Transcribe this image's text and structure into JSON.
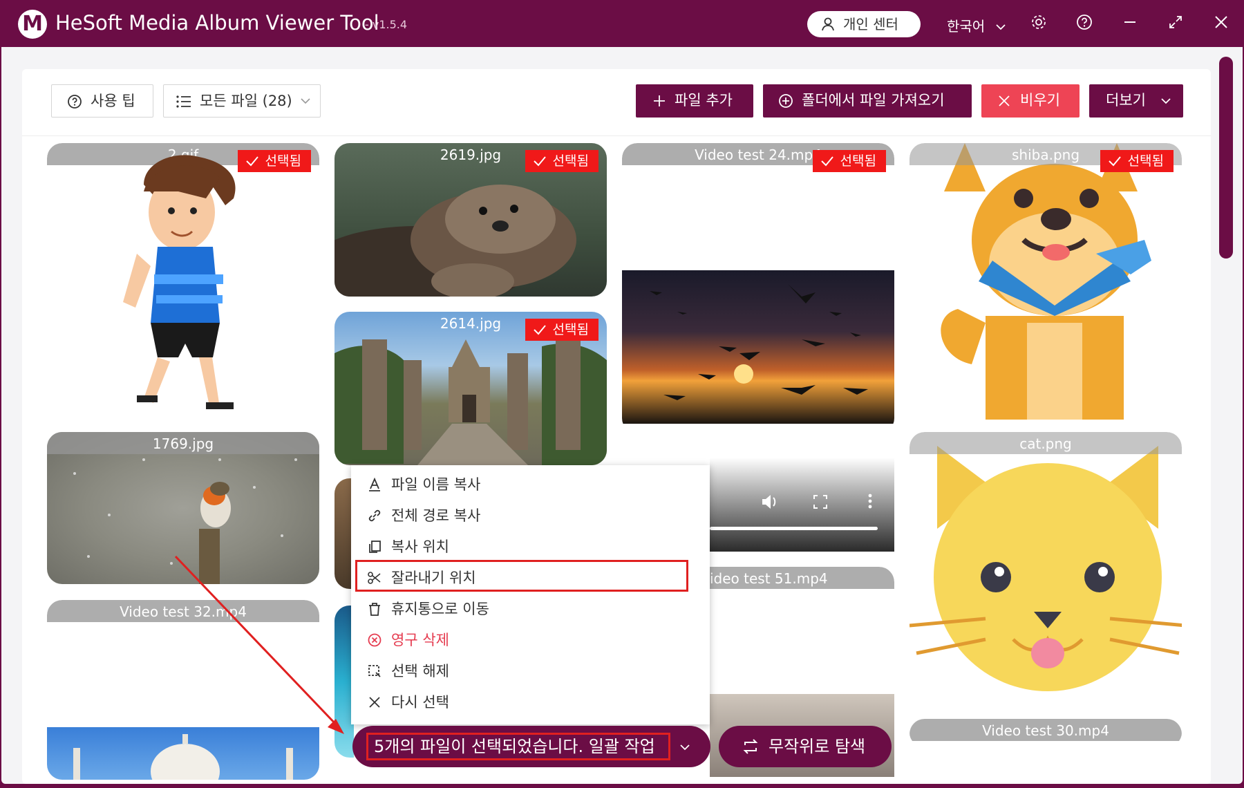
{
  "app": {
    "logo_letter": "M",
    "title": "HeSoft Media Album Viewer Tool",
    "version": "- v1.5.4",
    "user_center": "개인 센터",
    "language": "한국어"
  },
  "toolbar": {
    "tips_label": "사용 팁",
    "filter_label": "모든 파일 (28)",
    "add_file_label": "파일 추가",
    "import_folder_label": "폴더에서 파일 가져오기",
    "clear_label": "비우기",
    "more_label": "더보기"
  },
  "selected_badge": "선택됨",
  "cards": [
    {
      "name": "2.gif",
      "selected": true
    },
    {
      "name": "2619.jpg",
      "selected": true
    },
    {
      "name": "Video test 24.mp4",
      "selected": true
    },
    {
      "name": "shiba.png",
      "selected": true
    },
    {
      "name": "2614.jpg",
      "selected": true
    },
    {
      "name": "1769.jpg",
      "selected": false
    },
    {
      "name": "cat.png",
      "selected": false
    },
    {
      "name": "Video test 32.mp4",
      "selected": false
    },
    {
      "name": "ideo test 51.mp4",
      "selected": false
    },
    {
      "name": "Video test 30.mp4",
      "selected": false
    }
  ],
  "context_menu": {
    "items": [
      {
        "label": "파일 이름 복사",
        "icon": "text-a-icon"
      },
      {
        "label": "전체 경로 복사",
        "icon": "link-icon"
      },
      {
        "label": "복사 위치",
        "icon": "copy-icon"
      },
      {
        "label": "잘라내기 위치",
        "icon": "scissors-icon"
      },
      {
        "label": "휴지통으로 이동",
        "icon": "trash-icon"
      },
      {
        "label": "영구 삭제",
        "icon": "circle-x-icon"
      },
      {
        "label": "선택 해제",
        "icon": "deselect-icon"
      },
      {
        "label": "다시 선택",
        "icon": "x-icon"
      }
    ]
  },
  "bottom": {
    "batch_label": "5개의 파일이 선택되었습니다. 일괄 작업",
    "random_label": "무작위로 탐색"
  },
  "colors": {
    "brand": "#6b0d45",
    "danger": "#ee4455",
    "badge": "#f01919",
    "highlight": "#e02020"
  }
}
